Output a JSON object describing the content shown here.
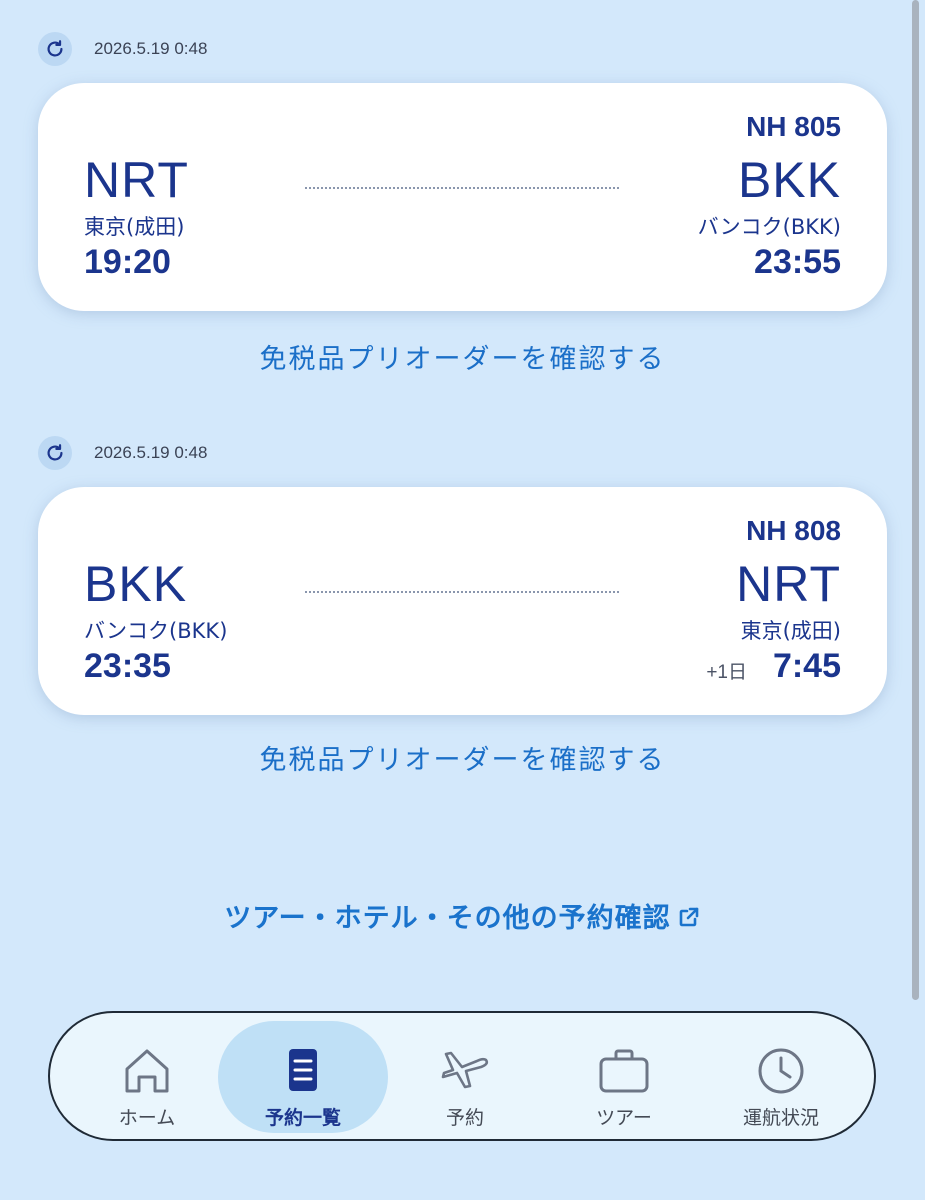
{
  "flights": [
    {
      "timestamp": "2026.5.19 0:48",
      "flight_no": "NH 805",
      "from_code": "NRT",
      "from_city": "東京(成田)",
      "dep_time": "19:20",
      "to_code": "BKK",
      "to_city": "バンコク(BKK)",
      "arr_time": "23:55",
      "day_offset": "",
      "duty_free_link": "免税品プリオーダーを確認する"
    },
    {
      "timestamp": "2026.5.19 0:48",
      "flight_no": "NH 808",
      "from_code": "BKK",
      "from_city": "バンコク(BKK)",
      "dep_time": "23:35",
      "to_code": "NRT",
      "to_city": "東京(成田)",
      "arr_time": "7:45",
      "day_offset": "+1日",
      "duty_free_link": "免税品プリオーダーを確認する"
    }
  ],
  "tour_link": "ツアー・ホテル・その他の予約確認",
  "tabbar": {
    "items": [
      {
        "label": "ホーム",
        "icon": "home-icon"
      },
      {
        "label": "予約一覧",
        "icon": "list-icon",
        "active": true
      },
      {
        "label": "予約",
        "icon": "airplane-icon"
      },
      {
        "label": "ツアー",
        "icon": "suitcase-icon"
      },
      {
        "label": "運航状況",
        "icon": "clock-icon"
      }
    ]
  },
  "colors": {
    "background": "#d3e8fb",
    "primary_text": "#1b358d",
    "link": "#1b6fc8",
    "active_tab": "#bfe0f6"
  }
}
